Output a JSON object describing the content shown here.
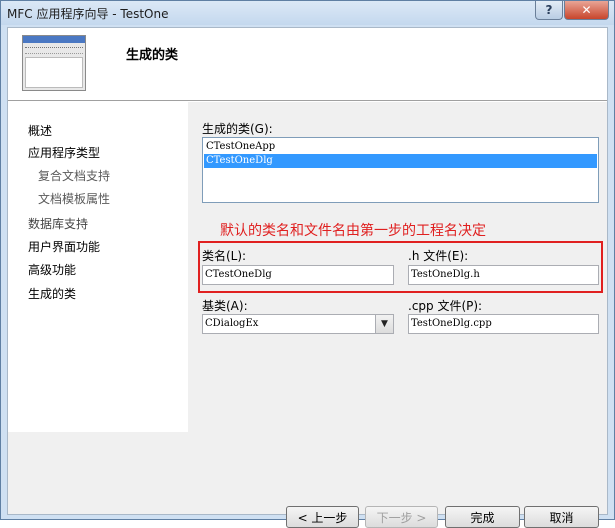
{
  "window": {
    "title": "MFC 应用程序向导 - TestOne",
    "help_glyph": "?",
    "close_glyph": "✕"
  },
  "header": {
    "title": "生成的类"
  },
  "nav": {
    "items": [
      {
        "label": "概述",
        "kind": "main"
      },
      {
        "label": "应用程序类型",
        "kind": "main"
      },
      {
        "label": "复合文档支持",
        "kind": "sub"
      },
      {
        "label": "文档模板属性",
        "kind": "sub"
      },
      {
        "label": "数据库支持",
        "kind": "main"
      },
      {
        "label": "用户界面功能",
        "kind": "main"
      },
      {
        "label": "高级功能",
        "kind": "main"
      },
      {
        "label": "生成的类",
        "kind": "main"
      }
    ]
  },
  "classes": {
    "label": "生成的类(G):",
    "list": [
      {
        "name": "CTestOneApp",
        "selected": false
      },
      {
        "name": "CTestOneDlg",
        "selected": true
      }
    ]
  },
  "annotation": {
    "text": "默认的类名和文件名由第一步的工程名决定",
    "color": "#e02020"
  },
  "fields": {
    "class_name_label": "类名(L):",
    "class_name_value": "CTestOneDlg",
    "h_file_label": ".h 文件(E):",
    "h_file_value": "TestOneDlg.h",
    "base_class_label": "基类(A):",
    "base_class_value": "CDialogEx",
    "cpp_file_label": ".cpp 文件(P):",
    "cpp_file_value": "TestOneDlg.cpp"
  },
  "buttons": {
    "back": "< 上一步",
    "next": "下一步 >",
    "finish": "完成",
    "cancel": "取消"
  },
  "colors": {
    "selection": "#3399ff",
    "accent_red": "#e02020"
  }
}
